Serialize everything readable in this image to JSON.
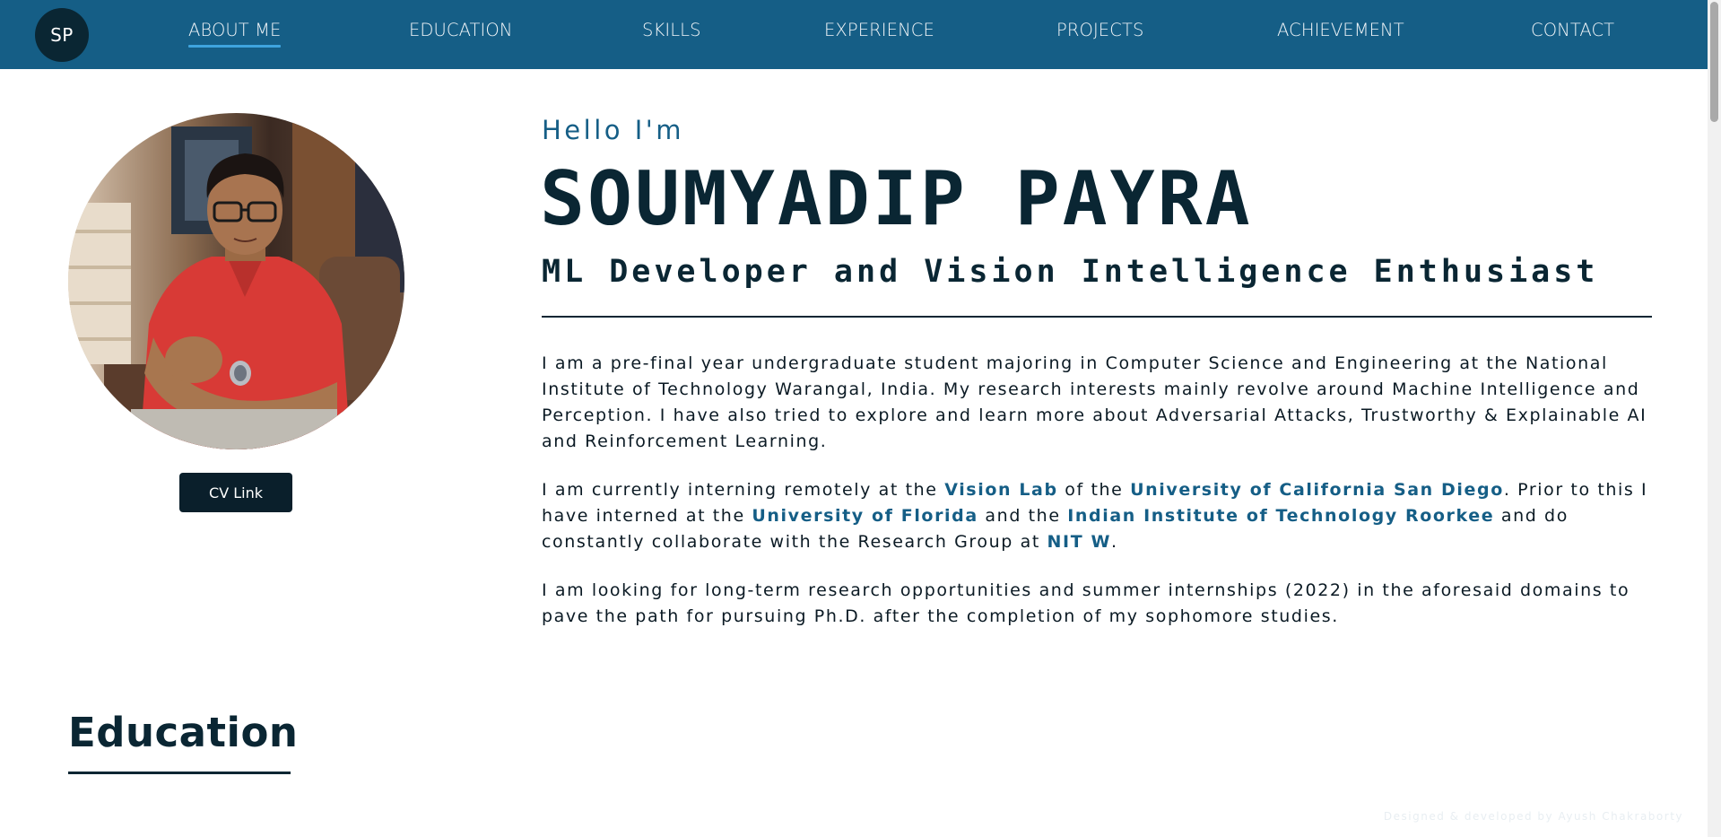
{
  "navbar": {
    "logo_text": "SP",
    "items": [
      {
        "label": "ABOUT ME",
        "active": true
      },
      {
        "label": "EDUCATION"
      },
      {
        "label": "SKILLS"
      },
      {
        "label": "EXPERIENCE"
      },
      {
        "label": "PROJECTS"
      },
      {
        "label": "ACHIEVEMENT"
      },
      {
        "label": "CONTACT"
      }
    ],
    "background_color": "#155e86",
    "active_underline_color": "#3fa4de"
  },
  "profile": {
    "photo_icon": "profile-photo",
    "cv_button_label": "CV Link"
  },
  "hero": {
    "greeting": "Hello I'm",
    "name": "SOUMYADIP PAYRA",
    "tagline": "ML Developer and Vision Intelligence Enthusiast"
  },
  "bio": {
    "p1": "I am a pre-final year undergraduate student majoring in Computer Science and Engineering at the National Institute of Technology Warangal, India. My research interests mainly revolve around Machine Intelligence and Perception. I have also tried to explore and learn more about Adversarial Attacks, Trustworthy & Explainable AI and Reinforcement Learning.",
    "p2": {
      "t1": "I am currently interning remotely at the ",
      "l1": "Vision Lab",
      "t2": " of the ",
      "l2": "University of California San Diego",
      "t3": ". Prior to this I have interned at the ",
      "l3": "University of Florida",
      "t4": " and the ",
      "l4": "Indian Institute of Technology Roorkee",
      "t5": " and do constantly collaborate with the Research Group at ",
      "l5": "NIT W",
      "t6": "."
    },
    "p3": "I am looking for long-term research opportunities and summer internships (2022) in the aforesaid domains to pave the path for pursuing Ph.D. after the completion of my sophomore studies.",
    "link_color": "#155e86"
  },
  "education": {
    "title": "Education"
  },
  "footer": {
    "credit": "Designed & developed by Ayush Chakraborty"
  }
}
